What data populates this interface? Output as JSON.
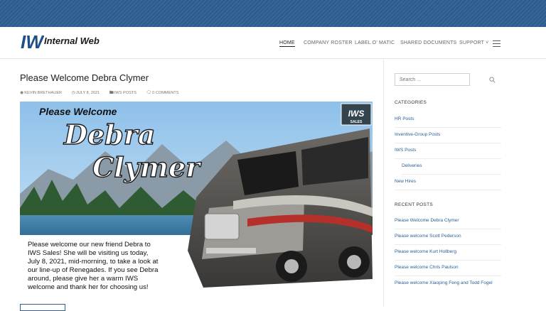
{
  "brand": {
    "logo_mark": "IW",
    "name": "Internal Web"
  },
  "nav": {
    "items": [
      {
        "label": "HOME",
        "active": true
      },
      {
        "label": "COMPANY ROSTER"
      },
      {
        "label": "LABEL O' MATIC"
      },
      {
        "label": "SHARED DOCUMENTS"
      },
      {
        "label": "SUPPORT ˅"
      }
    ],
    "menu_icon": "hamburger-icon"
  },
  "post": {
    "title": "Please Welcome Debra Clymer",
    "author": "KEVIN BRETHAUER",
    "date": "JULY 8, 2021",
    "category": "IWS POSTS",
    "comments": "0 COMMENTS"
  },
  "feature": {
    "heading": "Please Welcome",
    "name_line1": "Debra",
    "name_line2": "Clymer",
    "badge": "IWS",
    "badge_sub": "SALES",
    "message": [
      "Please welcome our new friend Debra to",
      "IWS Sales! She will be visiting us today,",
      "July 8, 2021, mid-morning, to take a look at",
      "our line-up of Renegades. If you see Debra",
      "around, please give her a warm IWS",
      "welcome and thank her for choosing us!"
    ]
  },
  "sidebar": {
    "search_placeholder": "Search ...",
    "categories_title": "CATEGORIES",
    "categories": [
      {
        "label": "HR Posts"
      },
      {
        "label": "Inventive-Group Posts"
      },
      {
        "label": "IWS Posts"
      },
      {
        "label": "Deliveries",
        "sub": true
      },
      {
        "label": "New Hires"
      }
    ],
    "recent_title": "RECENT POSTS",
    "recent": [
      {
        "label": "Please Welcome Debra Clymer"
      },
      {
        "label": "Please welcome Scott Pederson"
      },
      {
        "label": "Please welcome Kurt Hollberg"
      },
      {
        "label": "Please welcome Chris Paulson"
      },
      {
        "label": "Please welcome Xiaoping Feng and Todd Fogel"
      }
    ]
  },
  "colors": {
    "brand": "#2d5f94",
    "link": "#2d5f94"
  }
}
